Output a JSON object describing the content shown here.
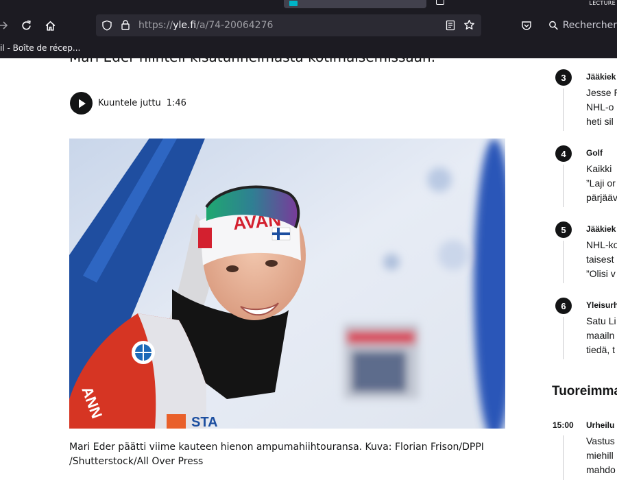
{
  "browser": {
    "reader_label": "LECTURE",
    "url_scheme": "https://",
    "url_host": "yle.fi",
    "url_path": "/a/74-20064276",
    "search_placeholder": "Rechercher",
    "bookmark_text": "il - Boîte de récep..."
  },
  "article": {
    "lead_partial": "Mari Eder hiihteli kisatunnelmasta kotimaisemissaan.",
    "listen_label": "Kuuntele juttu",
    "listen_time": "1:46",
    "photo_alt": "Mari Eder",
    "caption_line1": "Mari Eder päätti viime kauteen hienon ampumahiihtouransa. Kuva: Florian Frison/DPPI",
    "caption_line2": "/Shutterstock/All Over Press"
  },
  "sidebar": {
    "most_read": [
      {
        "num": "3",
        "category": "Jääkiek",
        "lines": [
          "Jesse P",
          "NHL-o",
          "heti sil"
        ]
      },
      {
        "num": "4",
        "category": "Golf",
        "lines": [
          "Kaikki",
          "”Laji or",
          "pärjääv"
        ]
      },
      {
        "num": "5",
        "category": "Jääkiek",
        "lines": [
          "NHL-ko",
          "taisest",
          "”Olisi v"
        ]
      },
      {
        "num": "6",
        "category": "Yleisurh",
        "lines": [
          "Satu Li",
          "maailn",
          "tiedä, t"
        ]
      }
    ],
    "latest_heading": "Tuoreimma",
    "latest": [
      {
        "time": "15:00",
        "category": "Urheilu",
        "lines": [
          "Vastus",
          "miehill",
          "mahdo"
        ]
      }
    ]
  },
  "colors": {
    "chrome_bg": "#1c1b22",
    "urlbar_bg": "#2b2a33",
    "text_dark": "#131415",
    "accent_teal": "#00b4c8"
  }
}
